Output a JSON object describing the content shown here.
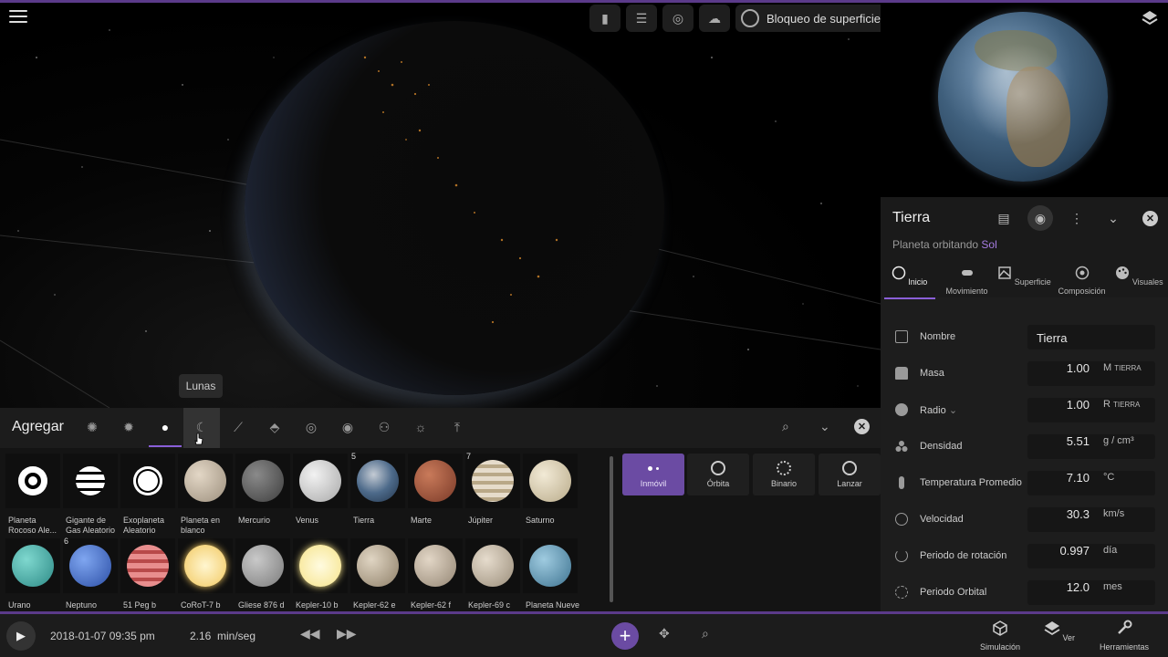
{
  "viewport": {
    "top_toolbar": {
      "surface_lock_label": "Bloqueo de superficie"
    }
  },
  "tooltip": "Lunas",
  "object_panel": {
    "title": "Tierra",
    "subtitle_prefix": "Planeta orbitando ",
    "subtitle_link": "Sol",
    "tabs": [
      {
        "label": "Inicio",
        "icon": "circle-icon"
      },
      {
        "label": "Movimiento",
        "icon": "motion-icon"
      },
      {
        "label": "Superficie",
        "icon": "surface-icon"
      },
      {
        "label": "Composición",
        "icon": "composition-icon"
      },
      {
        "label": "Visuales",
        "icon": "palette-icon"
      }
    ],
    "fields": [
      {
        "label": "Nombre",
        "value": "Tierra",
        "unit": "",
        "unit_sub": ""
      },
      {
        "label": "Masa",
        "value": "1.00",
        "unit": "M",
        "unit_sub": "TIERRA"
      },
      {
        "label": "Radio",
        "value": "1.00",
        "unit": "R",
        "unit_sub": "TIERRA"
      },
      {
        "label": "Densidad",
        "value": "5.51",
        "unit": "g / cm³",
        "unit_sub": ""
      },
      {
        "label": "Temperatura Promedio",
        "value": "7.10",
        "unit": "°C",
        "unit_sub": ""
      },
      {
        "label": "Velocidad",
        "value": "30.3",
        "unit": "km/s",
        "unit_sub": ""
      },
      {
        "label": "Periodo de rotación",
        "value": "0.997",
        "unit": "día",
        "unit_sub": ""
      },
      {
        "label": "Periodo Orbital",
        "value": "12.0",
        "unit": "mes",
        "unit_sub": ""
      }
    ]
  },
  "add_panel": {
    "title": "Agregar",
    "objects_row1": [
      {
        "label": "Planeta Rocoso Ale...",
        "badge": ""
      },
      {
        "label": "Gigante de Gas Aleatorio",
        "badge": ""
      },
      {
        "label": "Exoplaneta Aleatorio",
        "badge": ""
      },
      {
        "label": "Planeta en blanco",
        "badge": ""
      },
      {
        "label": "Mercurio",
        "badge": ""
      },
      {
        "label": "Venus",
        "badge": ""
      },
      {
        "label": "Tierra",
        "badge": "5"
      },
      {
        "label": "Marte",
        "badge": ""
      },
      {
        "label": "Júpiter",
        "badge": "7"
      },
      {
        "label": "Saturno",
        "badge": ""
      }
    ],
    "objects_row2": [
      {
        "label": "Urano",
        "badge": ""
      },
      {
        "label": "Neptuno",
        "badge": "6"
      },
      {
        "label": "51 Peg b",
        "badge": ""
      },
      {
        "label": "CoRoT-7 b",
        "badge": ""
      },
      {
        "label": "Gliese 876 d",
        "badge": ""
      },
      {
        "label": "Kepler-10 b",
        "badge": ""
      },
      {
        "label": "Kepler-62 e",
        "badge": ""
      },
      {
        "label": "Kepler-62 f",
        "badge": ""
      },
      {
        "label": "Kepler-69 c",
        "badge": ""
      },
      {
        "label": "Planeta Nueve",
        "badge": ""
      }
    ],
    "modes": [
      {
        "label": "Inmóvil"
      },
      {
        "label": "Órbita"
      },
      {
        "label": "Binario"
      },
      {
        "label": "Lanzar"
      }
    ]
  },
  "bottom_bar": {
    "datetime": "2018-01-07 09:35 pm",
    "rate_value": "2.16",
    "rate_unit": "min/seg",
    "tools": [
      {
        "label": "Simulación"
      },
      {
        "label": "Ver"
      },
      {
        "label": "Herramientas"
      }
    ]
  },
  "colors": {
    "accent": "#6b4ba3",
    "link": "#a57be0",
    "panel_bg": "#1d1d1d"
  }
}
